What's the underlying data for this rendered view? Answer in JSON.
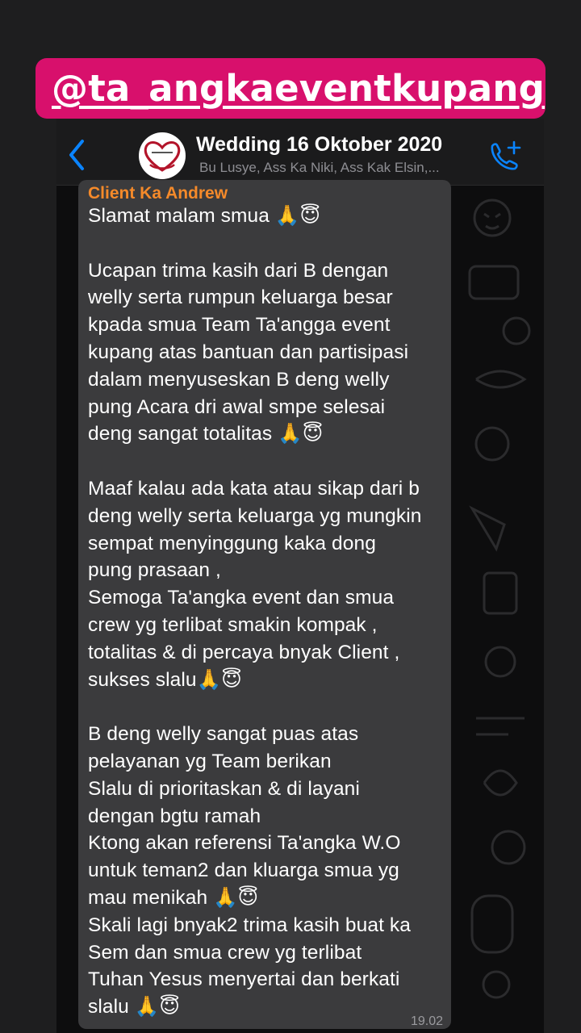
{
  "story_tag": {
    "text": "@ta_angkaeventkupang"
  },
  "chat": {
    "title": "Wedding 16 Oktober 2020",
    "subtitle": "Bu Lusye, Ass Ka Niki, Ass Kak Elsin,...",
    "icons": {
      "back": "chevron-left-icon",
      "call": "add-call-icon",
      "avatar": "group-avatar"
    },
    "accent": "#0a84ff"
  },
  "message": {
    "sender": "Client Ka Andrew",
    "sender_color": "#f58a2a",
    "text": "Slamat malam smua 🙏😇\n\nUcapan trima kasih dari B dengan\nwelly serta rumpun keluarga besar\nkpada smua Team Ta'angga event\nkupang atas bantuan dan partisipasi\ndalam menyuseskan B deng welly\npung Acara dri awal smpe selesai\ndeng sangat totalitas 🙏😇\n\nMaaf kalau ada kata atau sikap dari b\ndeng welly serta keluarga yg mungkin\nsempat menyinggung kaka dong\npung prasaan ,\nSemoga Ta'angka event dan smua\ncrew yg terlibat smakin kompak ,\ntotalitas & di percaya bnyak Client ,\nsukses slalu🙏😇\n\nB deng welly sangat puas atas\npelayanan yg Team berikan\nSlalu di prioritaskan & di layani\ndengan bgtu ramah\nKtong akan referensi Ta'angka W.O\nuntuk teman2 dan kluarga smua yg\nmau menikah 🙏😇\nSkali lagi bnyak2 trima kasih buat ka\nSem dan smua crew yg terlibat\nTuhan Yesus menyertai dan berkati\nslalu 🙏😇",
    "time": "19.02"
  }
}
